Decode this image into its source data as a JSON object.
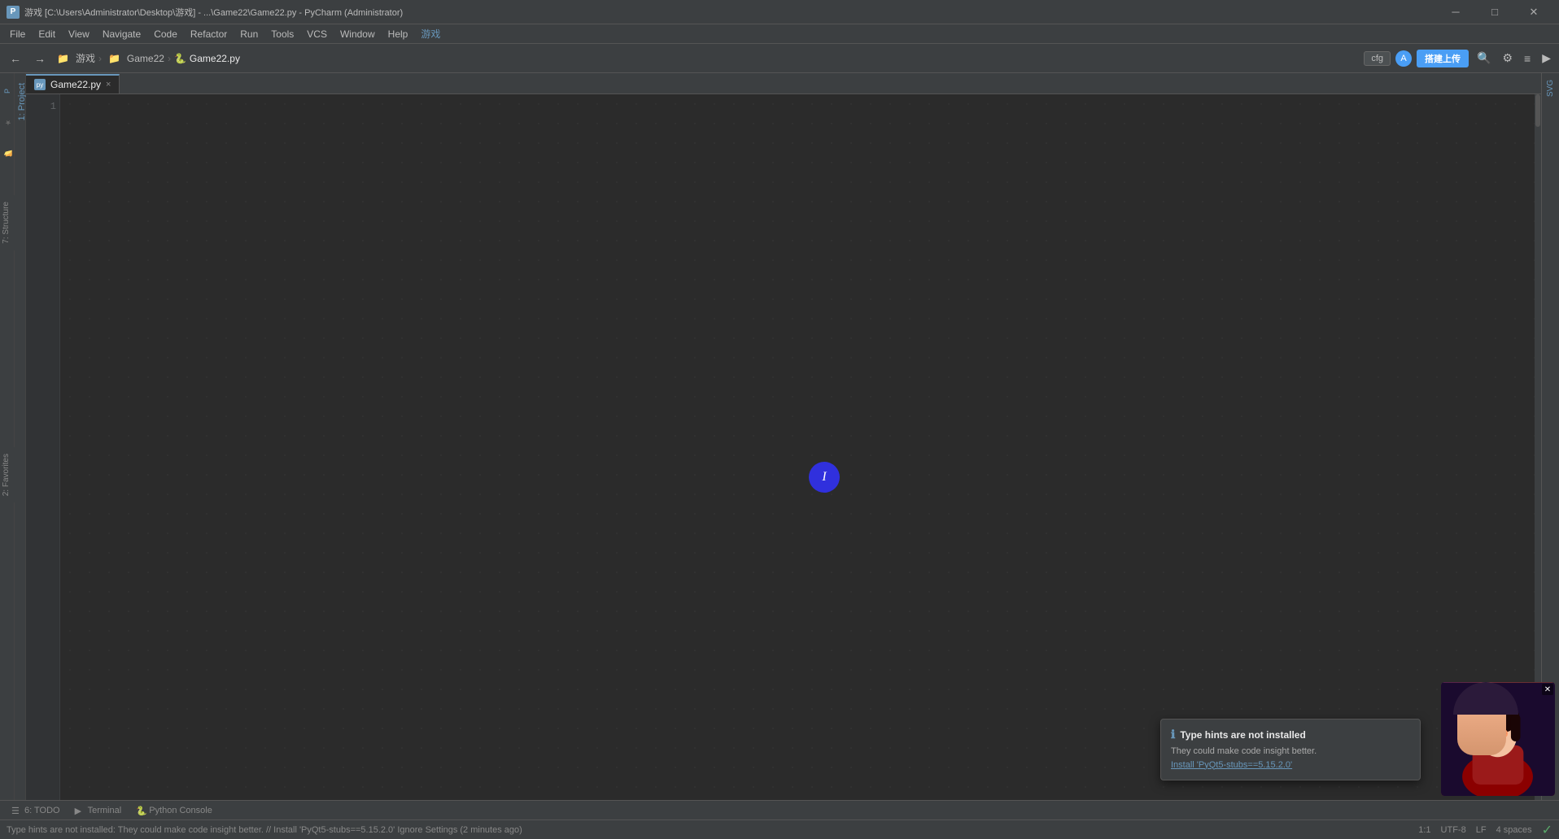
{
  "window": {
    "title": "游戏 [C:\\Users\\Administrator\\Desktop\\游戏] - ...\\Game22\\Game22.py - PyCharm (Administrator)",
    "minimize_label": "─",
    "maximize_label": "□",
    "close_label": "✕"
  },
  "menu": {
    "items": [
      "File",
      "Edit",
      "View",
      "Navigate",
      "Code",
      "Refactor",
      "Run",
      "Tools",
      "VCS",
      "Window",
      "Help",
      "游戏"
    ]
  },
  "toolbar": {
    "breadcrumb_project": "游戏",
    "breadcrumb_folder": "Game22",
    "breadcrumb_file": "Game22.py",
    "cfg_label": "cfg",
    "upload_label": "搭建上传"
  },
  "file_tab": {
    "name": "Game22.py",
    "close_symbol": "×"
  },
  "editor": {
    "line_numbers": [
      "1"
    ],
    "cursor_char": "I"
  },
  "left_panels": {
    "project_label": "1: Project",
    "structure_label": "7: Structure",
    "favorites_label": "2: Favorites"
  },
  "right_panels": {
    "svg_label": "SVG"
  },
  "status_bar": {
    "position": "1:1",
    "encoding": "UTF-8",
    "line_ending": "LF",
    "spaces": "4 spaces",
    "check_symbol": "✓"
  },
  "bottom_toolbar": {
    "todo_icon": "☰",
    "todo_label": "6: TODO",
    "terminal_icon": "▶",
    "terminal_label": "Terminal",
    "python_console_icon": "🐍",
    "python_console_label": "Python Console"
  },
  "notification": {
    "icon": "ℹ",
    "title": "Type hints are not installed",
    "body": "They could make code insight better.",
    "link_text": "Install 'PyQt5-stubs==5.15.2.0'",
    "install_prefix": "Install 'PyQt5-stubs==5.15.2.0'"
  },
  "status_message": {
    "text": "Type hints are not installed: They could make code insight better. // Install 'PyQt5-stubs==5.15.2.0'  Ignore    Settings  (2 minutes ago)"
  },
  "colors": {
    "accent": "#6897bb",
    "bg_dark": "#2b2b2b",
    "bg_medium": "#3c3f41",
    "text_primary": "#a9b7c6",
    "status_green": "#59a869",
    "cursor_blue": "#3030cc"
  }
}
